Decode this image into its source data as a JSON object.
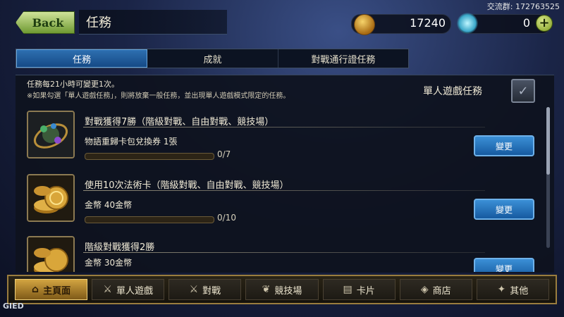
{
  "header": {
    "back_label": "Back",
    "title": "任務",
    "watermark": "交流群: 172763525",
    "coins": "17240",
    "crystals": "0",
    "plus_label": "+"
  },
  "tabs": [
    {
      "label": "任務",
      "active": true
    },
    {
      "label": "成就",
      "active": false
    },
    {
      "label": "對戰通行證任務",
      "active": false
    }
  ],
  "info": {
    "line1": "任務每21小時可變更1次。",
    "line2": "※如果勾選「單人遊戲任務」，則將放棄一般任務，並出現單人遊戲模式限定的任務。",
    "single_player_label": "單人遊戲任務",
    "single_player_checked": true
  },
  "missions": [
    {
      "name": "對戰獲得7勝（階級對戰、自由對戰、競技場）",
      "reward": "物語重歸卡包兌換券 1張",
      "progress_text": "0/7",
      "progress": 0,
      "button": "變更",
      "icon": "card-pack-icon"
    },
    {
      "name": "使用10次法術卡（階級對戰、自由對戰、競技場）",
      "reward": "金幣 40金幣",
      "progress_text": "0/10",
      "progress": 0,
      "button": "變更",
      "icon": "gold-coins-icon"
    },
    {
      "name": "階級對戰獲得2勝",
      "reward": "金幣 30金幣",
      "progress_text": "",
      "progress": 0,
      "button": "變更",
      "icon": "gold-coins-icon"
    }
  ],
  "nav": [
    {
      "label": "主頁面",
      "icon": "home-icon",
      "active": true
    },
    {
      "label": "單人遊戲",
      "icon": "swords-icon",
      "active": false
    },
    {
      "label": "對戰",
      "icon": "crossed-swords-icon",
      "active": false
    },
    {
      "label": "競技場",
      "icon": "laurel-icon",
      "active": false
    },
    {
      "label": "卡片",
      "icon": "cards-icon",
      "active": false
    },
    {
      "label": "商店",
      "icon": "shop-icon",
      "active": false
    },
    {
      "label": "其他",
      "icon": "other-icon",
      "active": false
    }
  ],
  "corner_mark": "GIED",
  "colors": {
    "accent_blue": "#2d6fb0",
    "gold": "#d2a441",
    "back_green": "#8fb84a"
  }
}
